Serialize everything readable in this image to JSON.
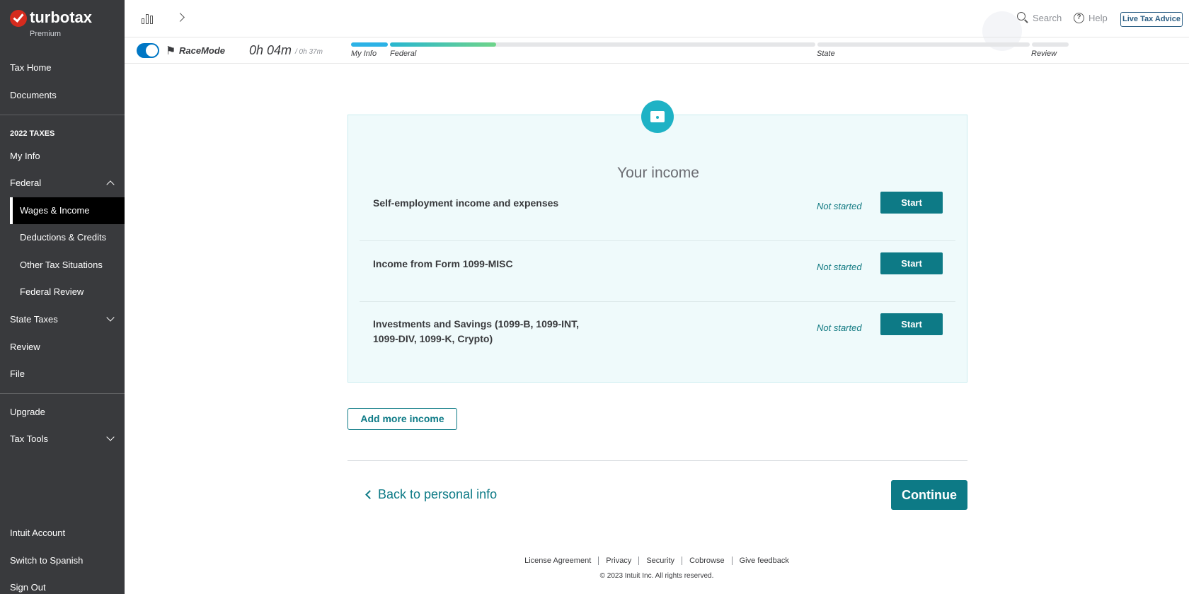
{
  "brand": {
    "name": "turbotax",
    "edition": "Premium"
  },
  "sidebar": {
    "items": [
      {
        "label": "Tax Home"
      },
      {
        "label": "Documents"
      },
      {
        "label": "2022 TAXES"
      },
      {
        "label": "My Info"
      },
      {
        "label": "Federal"
      },
      {
        "label": "Wages & Income"
      },
      {
        "label": "Deductions & Credits"
      },
      {
        "label": "Other Tax Situations"
      },
      {
        "label": "Federal Review"
      },
      {
        "label": "State Taxes"
      },
      {
        "label": "Review"
      },
      {
        "label": "File"
      },
      {
        "label": "Upgrade"
      },
      {
        "label": "Tax Tools"
      },
      {
        "label": "Intuit Account"
      },
      {
        "label": "Switch to Spanish"
      },
      {
        "label": "Sign Out"
      }
    ]
  },
  "header": {
    "search": "Search",
    "help": "Help",
    "live_advice": "Live Tax Advice"
  },
  "race": {
    "label": "RaceMode",
    "elapsed": "0h 04m",
    "estimate": "/ 0h 37m",
    "enabled": true,
    "steps": [
      {
        "label": "My Info",
        "progress": 1.0
      },
      {
        "label": "Federal",
        "progress": 0.25
      },
      {
        "label": "State",
        "progress": 0
      },
      {
        "label": "Review",
        "progress": 0
      }
    ]
  },
  "card": {
    "title": "Your income",
    "rows": [
      {
        "label": "Self-employment income and expenses",
        "status": "Not started",
        "button": "Start"
      },
      {
        "label": "Income from Form 1099-MISC",
        "status": "Not started",
        "button": "Start"
      },
      {
        "label": "Investments and Savings (1099-B, 1099-INT, 1099-DIV, 1099-K, Crypto)",
        "status": "Not started",
        "button": "Start"
      }
    ]
  },
  "add_more": "Add more income",
  "back": "Back to personal info",
  "continue": "Continue",
  "footer": {
    "links": [
      "License Agreement",
      "Privacy",
      "Security",
      "Cobrowse",
      "Give feedback"
    ],
    "copyright": "© 2023 Intuit Inc. All rights reserved."
  },
  "colors": {
    "sidebar": "#393a3d",
    "teal": "#0d7a86",
    "brand_red": "#d52b1e"
  }
}
